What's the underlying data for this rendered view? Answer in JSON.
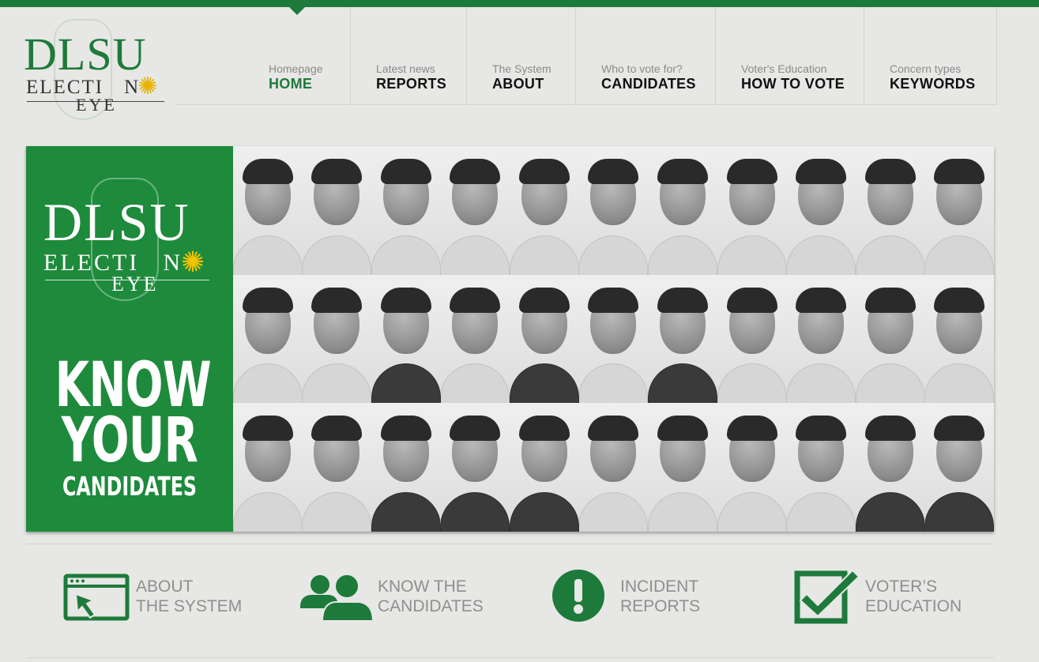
{
  "brand": {
    "logo_line1": "DLSU",
    "logo_line2": "ELECTI",
    "logo_line2b": "N",
    "logo_line3": "EYE"
  },
  "colors": {
    "accent": "#1e7a3b",
    "banner_green": "#1e8a3c",
    "sun": "#e8b300"
  },
  "nav": {
    "items": [
      {
        "sub": "Homepage",
        "main": "HOME",
        "active": true
      },
      {
        "sub": "Latest news",
        "main": "REPORTS"
      },
      {
        "sub": "The System",
        "main": "ABOUT"
      },
      {
        "sub": "Who to vote for?",
        "main": "CANDIDATES"
      },
      {
        "sub": "Voter's Education",
        "main": "HOW TO VOTE"
      },
      {
        "sub": "Concern types",
        "main": "KEYWORDS"
      }
    ]
  },
  "banner": {
    "line1": "KNOW",
    "line2": "YOUR",
    "line3": "CANDIDATES"
  },
  "features": [
    {
      "icon": "browser-cursor-icon",
      "line1": "ABOUT",
      "line2": "THE SYSTEM"
    },
    {
      "icon": "people-icon",
      "line1": "KNOW THE",
      "line2": "CANDIDATES"
    },
    {
      "icon": "exclamation-icon",
      "line1": "INCIDENT",
      "line2": "REPORTS"
    },
    {
      "icon": "checkbox-icon",
      "line1": "VOTER’S",
      "line2": "EDUCATION"
    }
  ]
}
